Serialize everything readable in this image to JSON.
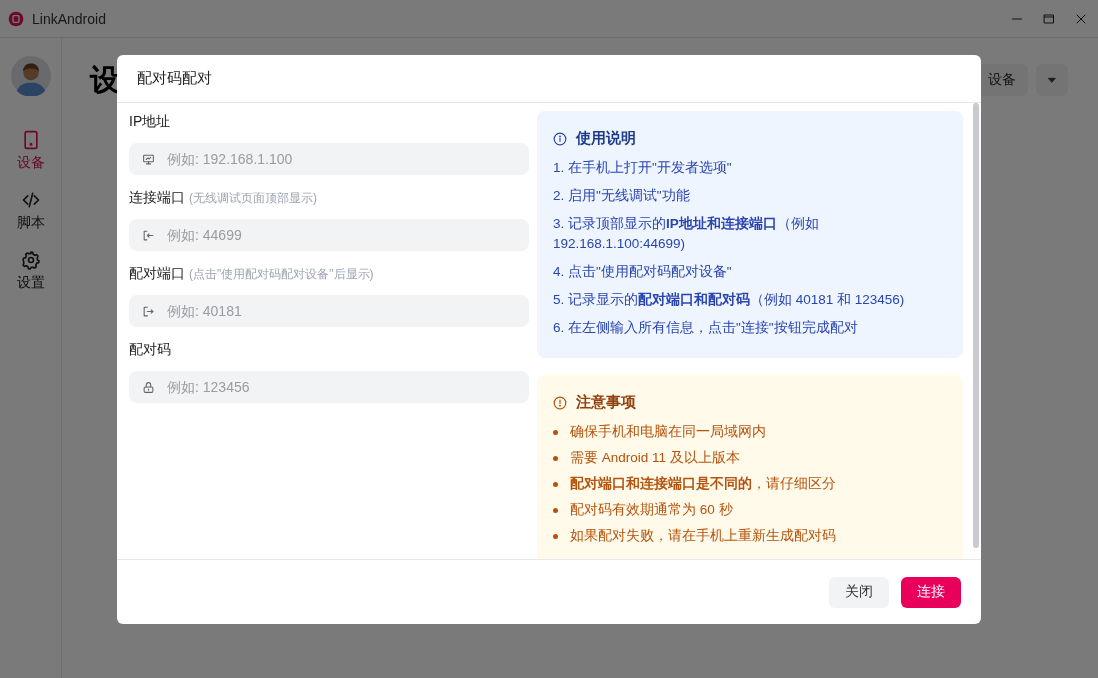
{
  "window": {
    "title": "LinkAndroid"
  },
  "sidebar": {
    "items": [
      {
        "label": "设备",
        "selected": true
      },
      {
        "label": "脚本",
        "selected": false
      },
      {
        "label": "设置",
        "selected": false
      }
    ]
  },
  "page": {
    "heading": "设",
    "action_button": "设备"
  },
  "dialog": {
    "title": "配对码配对",
    "fields": [
      {
        "label": "IP地址",
        "placeholder": "例如: 192.168.1.100"
      },
      {
        "label": "连接端口",
        "hint": "(无线调试页面顶部显示)",
        "placeholder": "例如: 44699"
      },
      {
        "label": "配对端口",
        "hint": "(点击\"使用配对码配对设备\"后显示)",
        "placeholder": "例如: 40181"
      },
      {
        "label": "配对码",
        "placeholder": "例如: 123456"
      }
    ],
    "instructions": {
      "title": "使用说明",
      "steps": [
        "1. 在手机上打开\"开发者选项\"",
        "2. 启用\"无线调试\"功能",
        "3. 记录顶部显示的**IP地址和连接端口**（例如 192.168.1.100:44699)",
        "4. 点击\"使用配对码配对设备\"",
        "5. 记录显示的**配对端口和配对码**（例如 40181 和 123456)",
        "6. 在左侧输入所有信息，点击\"连接\"按钮完成配对"
      ]
    },
    "notes": {
      "title": "注意事项",
      "items": [
        "确保手机和电脑在同一局域网内",
        "需要 Android 11 及以上版本",
        "**配对端口和连接端口是不同的**，请仔细区分",
        "配对码有效期通常为 60 秒",
        "如果配对失败，请在手机上重新生成配对码"
      ]
    },
    "buttons": [
      {
        "label": "关闭",
        "kind": "secondary"
      },
      {
        "label": "连接",
        "kind": "primary"
      }
    ]
  }
}
